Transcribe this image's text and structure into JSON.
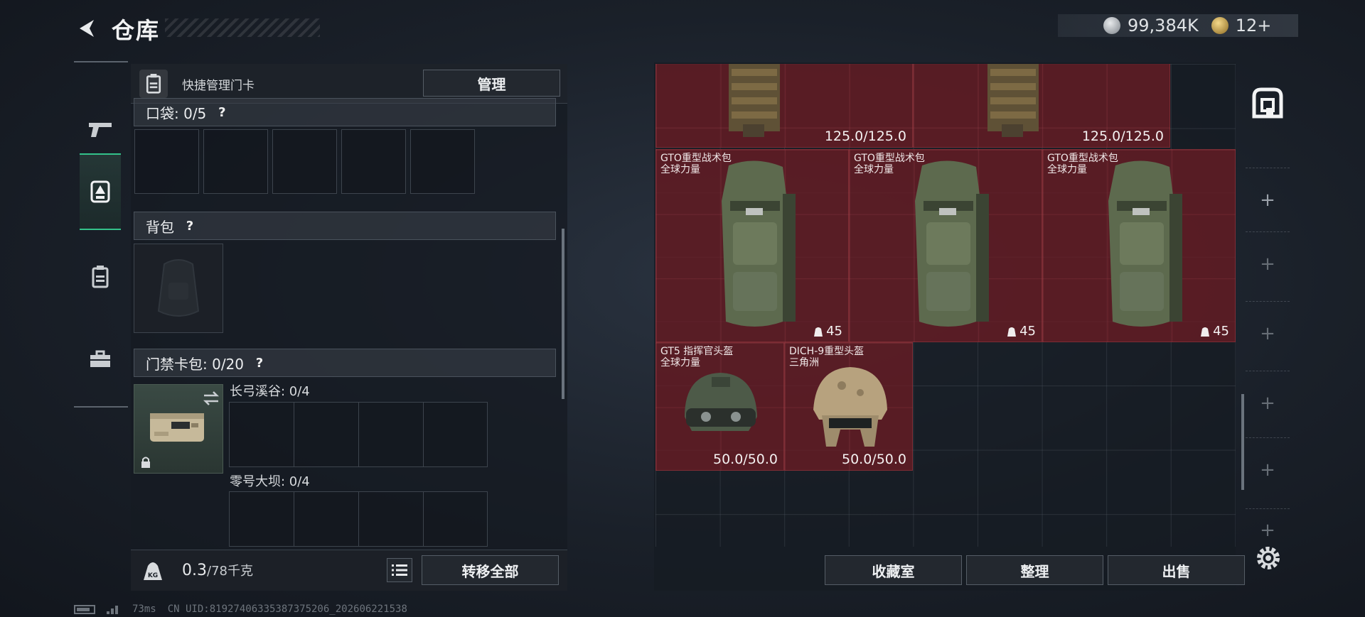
{
  "header": {
    "title": "仓库"
  },
  "currency": {
    "silver": "99,384K",
    "gold": "12+"
  },
  "left": {
    "keycard_label": "快捷管理门卡",
    "manage_button": "管理",
    "pocket_label": "口袋: 0/5",
    "backpack_label": "背包",
    "keycard_bag_label": "门禁卡包: 0/20",
    "help": "?",
    "card_slots": [
      {
        "label": "长弓溪谷: 0/4"
      },
      {
        "label": "零号大坝: 0/4"
      }
    ],
    "weight": "0.3",
    "weight_cap": "/78千克",
    "transfer_button": "转移全部"
  },
  "storage": {
    "items": [
      {
        "kind": "vest",
        "name": "",
        "sub": "",
        "value": "125.0/125.0"
      },
      {
        "kind": "vest",
        "name": "",
        "sub": "",
        "value": "125.0/125.0"
      },
      {
        "kind": "backpack",
        "name": "GTO重型战术包",
        "sub": "全球力量",
        "value": "45"
      },
      {
        "kind": "backpack",
        "name": "GTO重型战术包",
        "sub": "全球力量",
        "value": "45"
      },
      {
        "kind": "backpack",
        "name": "GTO重型战术包",
        "sub": "全球力量",
        "value": "45"
      },
      {
        "kind": "helmet",
        "name": "GT5 指挥官头盔",
        "sub": "全球力量",
        "value": "50.0/50.0"
      },
      {
        "kind": "helmet",
        "name": "DICH-9重型头盔",
        "sub": "三角洲",
        "value": "50.0/50.0"
      }
    ],
    "buttons": {
      "collection": "收藏室",
      "sort": "整理",
      "sell": "出售"
    },
    "side_plus": "+"
  },
  "status": {
    "ping": "73ms",
    "uid": "CN UID:819274063353873752​06_202606221538"
  },
  "colors": {
    "accent": "#33c28a",
    "item_bg": "#6e1c24"
  }
}
